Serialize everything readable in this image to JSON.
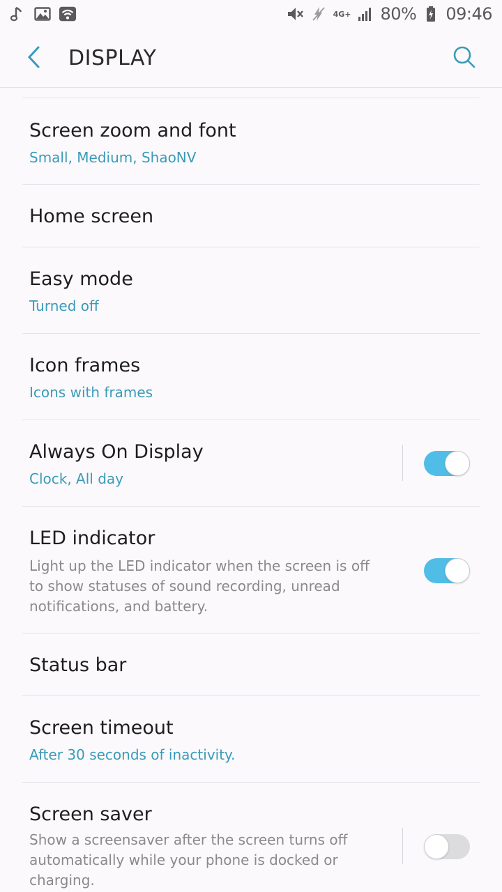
{
  "status_bar": {
    "left_icons": [
      "music-note-icon",
      "image-icon",
      "wifi-icon"
    ],
    "right_icons": [
      "mute-icon",
      "no-data-icon",
      "signal-icon"
    ],
    "network": "4G+",
    "battery": "80%",
    "time": "09:46"
  },
  "header": {
    "title": "DISPLAY",
    "back_icon": "back-arrow-icon",
    "search_icon": "search-icon"
  },
  "accent_color": "#3a9bb8",
  "toggle_on_color": "#4fbde6",
  "settings": [
    {
      "title": "Screen zoom and font",
      "summary": "Small, Medium, ShaoNV"
    },
    {
      "title": "Home screen"
    },
    {
      "title": "Easy mode",
      "summary": "Turned off"
    },
    {
      "title": "Icon frames",
      "summary": "Icons with frames"
    },
    {
      "title": "Always On Display",
      "summary": "Clock, All day",
      "toggle": true
    },
    {
      "title": "LED indicator",
      "description": "Light up the LED indicator when the screen is off to show statuses of sound recording, unread notifications, and battery.",
      "toggle": true
    },
    {
      "title": "Status bar"
    },
    {
      "title": "Screen timeout",
      "summary": "After 30 seconds of inactivity."
    },
    {
      "title": "Screen saver",
      "description": "Show a screensaver after the screen turns off automatically while your phone is docked or charging.",
      "toggle": false
    }
  ]
}
